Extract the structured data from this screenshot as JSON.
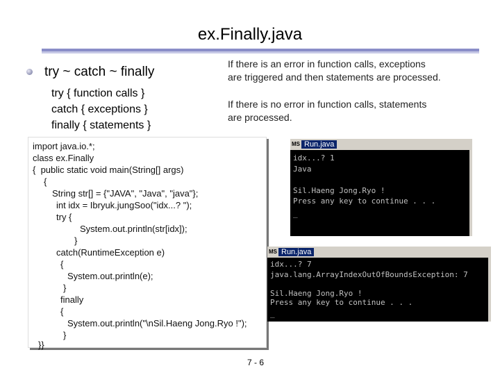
{
  "slide": {
    "title": "ex.Finally.java",
    "heading": "try ~ catch ~ finally",
    "sub_lines": [
      "try { function calls }",
      "catch { exceptions }",
      "finally { statements }"
    ],
    "notes": [
      [
        "If there is an error in function calls, exceptions",
        "are triggered and then statements are processed."
      ],
      [
        "If there is no error in function calls, statements",
        "are processed."
      ]
    ],
    "page_number": "7 - 6"
  },
  "code": {
    "lines": [
      "import java.io.*;",
      "class ex.Finally",
      "{  public static void main(String[] args)",
      "{",
      "String str[] = {\"JAVA\", \"Java\", \"java\"};",
      "int idx = Ibryuk.jungSoo(\"idx...? \");",
      "try {",
      "System.out.println(str[idx]);",
      "}",
      "catch(RuntimeException e)",
      "{",
      "System.out.println(e);",
      "}",
      "finally",
      "{",
      "System.out.println(\"\\nSil.Haeng Jong.Ryo !\");",
      "}",
      "}}"
    ]
  },
  "console1": {
    "icon_label": "MS",
    "title": "Run.java",
    "lines": [
      "idx...? 1",
      "Java",
      "",
      "Sil.Haeng Jong.Ryo !",
      "Press any key to continue . . .",
      "_"
    ]
  },
  "console2": {
    "icon_label": "MS",
    "title": "Run.java",
    "lines": [
      "idx...? 7",
      "java.lang.ArrayIndexOutOfBoundsException: 7",
      "",
      "Sil.Haeng Jong.Ryo !",
      "Press any key to continue . . .",
      "_"
    ]
  }
}
